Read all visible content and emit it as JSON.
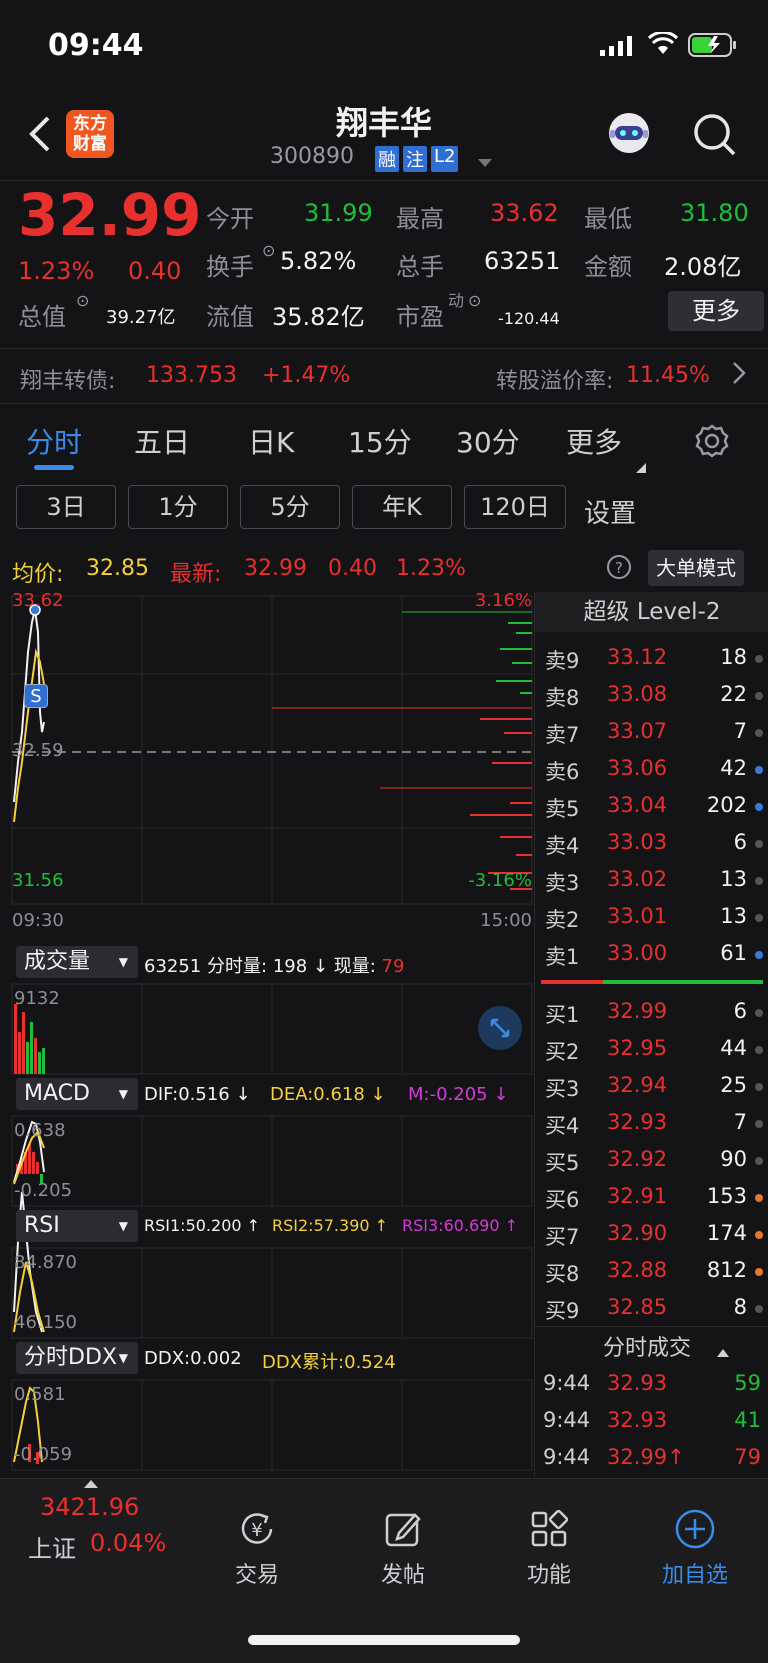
{
  "status": {
    "time": "09:44"
  },
  "nav": {
    "title": "翔丰华",
    "code": "300890",
    "badges": [
      "融",
      "注",
      "L2"
    ],
    "logo_text": "东方\n财富",
    "logo_line1": "东方",
    "logo_line2": "财富"
  },
  "quote": {
    "price": "32.99",
    "pct": "1.23%",
    "change": "0.40",
    "open_label": "今开",
    "open": "31.99",
    "high_label": "最高",
    "high": "33.62",
    "low_label": "最低",
    "low": "31.80",
    "turnover_label": "换手",
    "turnover": "5.82%",
    "volume_label": "总手",
    "volume": "63251",
    "amount_label": "金额",
    "amount": "2.08亿",
    "mktcap_label": "总值",
    "mktcap": "39.27亿",
    "float_label": "流值",
    "float": "35.82亿",
    "pe_label": "市盈",
    "pe_sup": "动",
    "pe": "-120.44",
    "more_button": "更多"
  },
  "bond": {
    "label": "翔丰转债:",
    "price": "133.753",
    "pct": "+1.47%",
    "premium_label": "转股溢价率:",
    "premium": "11.45%"
  },
  "tabs": [
    "分时",
    "五日",
    "日K",
    "15分",
    "30分",
    "更多"
  ],
  "subtabs": [
    "3日",
    "1分",
    "5分",
    "年K",
    "120日"
  ],
  "subtabs_settings": "设置",
  "avgbar": {
    "avg_label": "均价:",
    "avg": "32.85",
    "latest_label": "最新:",
    "latest": "32.99",
    "chg": "0.40",
    "pct": "1.23%",
    "mode_button": "大单模式"
  },
  "chart": {
    "y_top": "33.62",
    "y_mid": "32.59",
    "y_bottom": "31.56",
    "pct_top": "3.16%",
    "pct_bottom": "-3.16%",
    "x_start": "09:30",
    "x_end": "15:00",
    "marker": "S",
    "vol_label": "成交量",
    "vol_info_total": "63251",
    "vol_info_text": "分时量:",
    "vol_info_val": "198",
    "vol_arrow": "↓",
    "vol_now_label": "现量:",
    "vol_now": "79",
    "vol_max": "9132",
    "macd_label": "MACD",
    "macd_dif": "DIF:0.516 ↓",
    "macd_dea": "DEA:0.618 ↓",
    "macd_m": "M:-0.205 ↓",
    "macd_top": "0.638",
    "macd_bottom": "-0.205",
    "rsi_label": "RSI",
    "rsi1": "RSI1:50.200 ↑",
    "rsi2": "RSI2:57.390 ↑",
    "rsi3": "RSI3:60.690 ↑",
    "rsi_top": "84.870",
    "rsi_bottom": "46.150",
    "ddx_label": "分时DDX",
    "ddx": "DDX:0.002",
    "ddx_cum": "DDX累计:0.524",
    "ddx_top": "0.581",
    "ddx_bottom": "-0.059"
  },
  "chart_data": {
    "type": "line",
    "series": [
      {
        "values": [
          31.6,
          32.2,
          33.62,
          33.2,
          32.8,
          32.99
        ]
      }
    ],
    "ylim": [
      31.56,
      33.62
    ],
    "x": [
      "09:30",
      "15:00"
    ]
  },
  "book": {
    "title": "超级 Level-2",
    "sells": [
      {
        "label": "卖9",
        "price": "33.12",
        "vol": "18",
        "dot": "#555"
      },
      {
        "label": "卖8",
        "price": "33.08",
        "vol": "22",
        "dot": "#555"
      },
      {
        "label": "卖7",
        "price": "33.07",
        "vol": "7",
        "dot": "#555"
      },
      {
        "label": "卖6",
        "price": "33.06",
        "vol": "42",
        "dot": "#3a7bd5"
      },
      {
        "label": "卖5",
        "price": "33.04",
        "vol": "202",
        "dot": "#3a7bd5"
      },
      {
        "label": "卖4",
        "price": "33.03",
        "vol": "6",
        "dot": "#555"
      },
      {
        "label": "卖3",
        "price": "33.02",
        "vol": "13",
        "dot": "#555"
      },
      {
        "label": "卖2",
        "price": "33.01",
        "vol": "13",
        "dot": "#555"
      },
      {
        "label": "卖1",
        "price": "33.00",
        "vol": "61",
        "dot": "#3a7bd5"
      }
    ],
    "buys": [
      {
        "label": "买1",
        "price": "32.99",
        "vol": "6",
        "dot": "#555"
      },
      {
        "label": "买2",
        "price": "32.95",
        "vol": "44",
        "dot": "#555"
      },
      {
        "label": "买3",
        "price": "32.94",
        "vol": "25",
        "dot": "#555"
      },
      {
        "label": "买4",
        "price": "32.93",
        "vol": "7",
        "dot": "#555"
      },
      {
        "label": "买5",
        "price": "32.92",
        "vol": "90",
        "dot": "#555"
      },
      {
        "label": "买6",
        "price": "32.91",
        "vol": "153",
        "dot": "#e8742f"
      },
      {
        "label": "买7",
        "price": "32.90",
        "vol": "174",
        "dot": "#e8742f"
      },
      {
        "label": "买8",
        "price": "32.88",
        "vol": "812",
        "dot": "#e8742f"
      },
      {
        "label": "买9",
        "price": "32.85",
        "vol": "8",
        "dot": "#555"
      }
    ],
    "trades_title": "分时成交",
    "trades": [
      {
        "time": "9:44",
        "price": "32.93",
        "vol": "59",
        "color": "#1fbe3a"
      },
      {
        "time": "9:44",
        "price": "32.93",
        "vol": "41",
        "color": "#1fbe3a"
      },
      {
        "time": "9:44",
        "price": "32.99↑",
        "vol": "79",
        "color": "#e8302f"
      }
    ]
  },
  "bottom": {
    "index_value": "3421.96",
    "index_name": "上证",
    "index_pct": "0.04%",
    "tabs": [
      {
        "label": "交易",
        "icon": "yen-cycle-icon"
      },
      {
        "label": "发帖",
        "icon": "edit-icon"
      },
      {
        "label": "功能",
        "icon": "grid-icon"
      },
      {
        "label": "加自选",
        "icon": "plus-circle-icon"
      }
    ]
  }
}
